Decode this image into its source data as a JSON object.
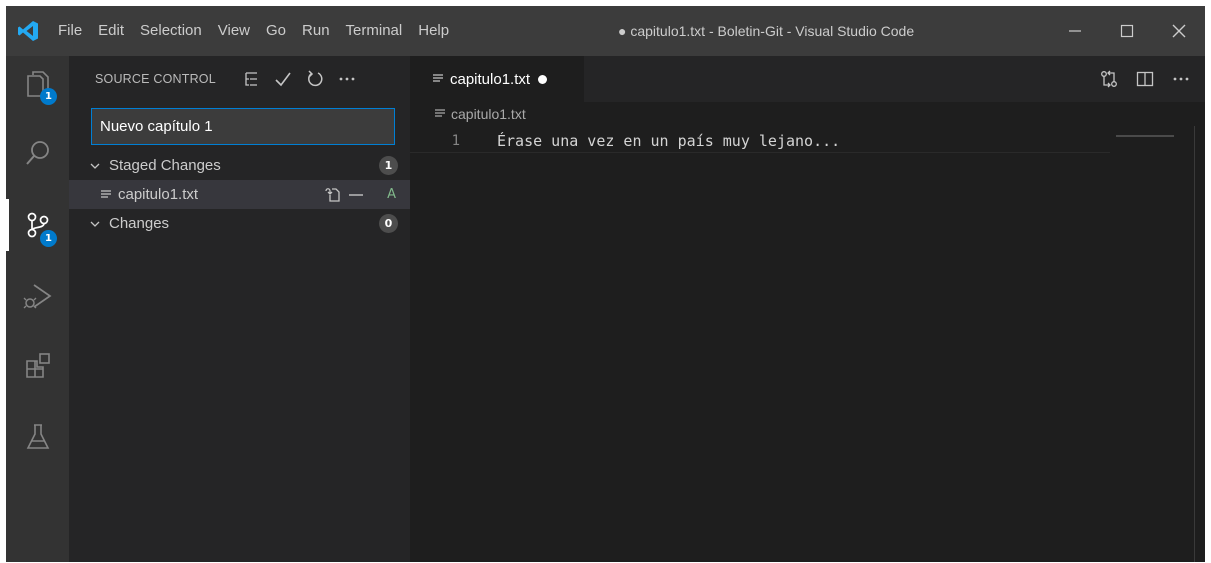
{
  "titlebar": {
    "menu": [
      "File",
      "Edit",
      "Selection",
      "View",
      "Go",
      "Run",
      "Terminal",
      "Help"
    ],
    "window_title": "● capitulo1.txt - Boletin-Git - Visual Studio Code",
    "accent": "#007acc"
  },
  "activitybar": {
    "items": [
      {
        "name": "explorer",
        "badge": "1"
      },
      {
        "name": "search"
      },
      {
        "name": "source-control",
        "badge": "1",
        "active": true
      },
      {
        "name": "run-debug"
      },
      {
        "name": "extensions"
      },
      {
        "name": "testing"
      }
    ]
  },
  "sidebar": {
    "title": "SOURCE CONTROL",
    "commit_message": "Nuevo capítulo 1",
    "staged": {
      "label": "Staged Changes",
      "count": "1"
    },
    "staged_file": {
      "name": "capitulo1.txt",
      "status": "A"
    },
    "changes": {
      "label": "Changes",
      "count": "0"
    }
  },
  "editor": {
    "tab": {
      "label": "capitulo1.txt",
      "dirty": true
    },
    "breadcrumb": "capitulo1.txt",
    "lines": [
      {
        "number": "1",
        "text": "Érase una vez en un país muy lejano..."
      }
    ]
  }
}
